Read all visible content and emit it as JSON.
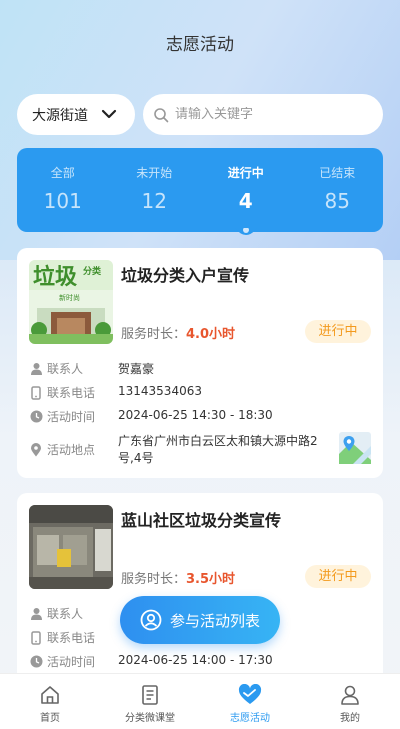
{
  "header": {
    "title": "志愿活动"
  },
  "filter": {
    "street": "大源街道",
    "search_placeholder": "请输入关键字"
  },
  "stats": [
    {
      "label": "全部",
      "count": "101"
    },
    {
      "label": "未开始",
      "count": "12"
    },
    {
      "label": "进行中",
      "count": "4",
      "active": true
    },
    {
      "label": "已结束",
      "count": "85"
    }
  ],
  "activities": [
    {
      "title": "垃圾分类入户宣传",
      "hours_label": "服务时长：",
      "hours_value": "4.0小时",
      "status": "进行中",
      "contact_label": "联系人",
      "contact": "贺嘉豪",
      "phone_label": "联系电话",
      "phone": "13143534063",
      "time_label": "活动时间",
      "time": "2024-06-25 14:30 - 18:30",
      "place_label": "活动地点",
      "place_line1": "广东省广州市白云区太和镇大源中路2",
      "place_line2": "号,4号",
      "thumb_text_main": "垃圾",
      "thumb_text_side": "分类",
      "thumb_text_sub": "新时尚"
    },
    {
      "title": "蓝山社区垃圾分类宣传",
      "hours_label": "服务时长：",
      "hours_value": "3.5小时",
      "status": "进行中",
      "contact_label": "联系人",
      "phone_label": "联系电话",
      "time_label": "活动时间",
      "time": "2024-06-25 14:00 - 17:30"
    }
  ],
  "float_button": {
    "label": "参与活动列表"
  },
  "tabbar": [
    {
      "label": "首页",
      "icon": "home-icon"
    },
    {
      "label": "分类微课堂",
      "icon": "document-icon"
    },
    {
      "label": "志愿活动",
      "icon": "heart-icon",
      "active": true
    },
    {
      "label": "我的",
      "icon": "user-icon"
    }
  ],
  "colors": {
    "accent": "#2b9af0",
    "hours": "#e8562e",
    "badge": "#f39a1e"
  }
}
